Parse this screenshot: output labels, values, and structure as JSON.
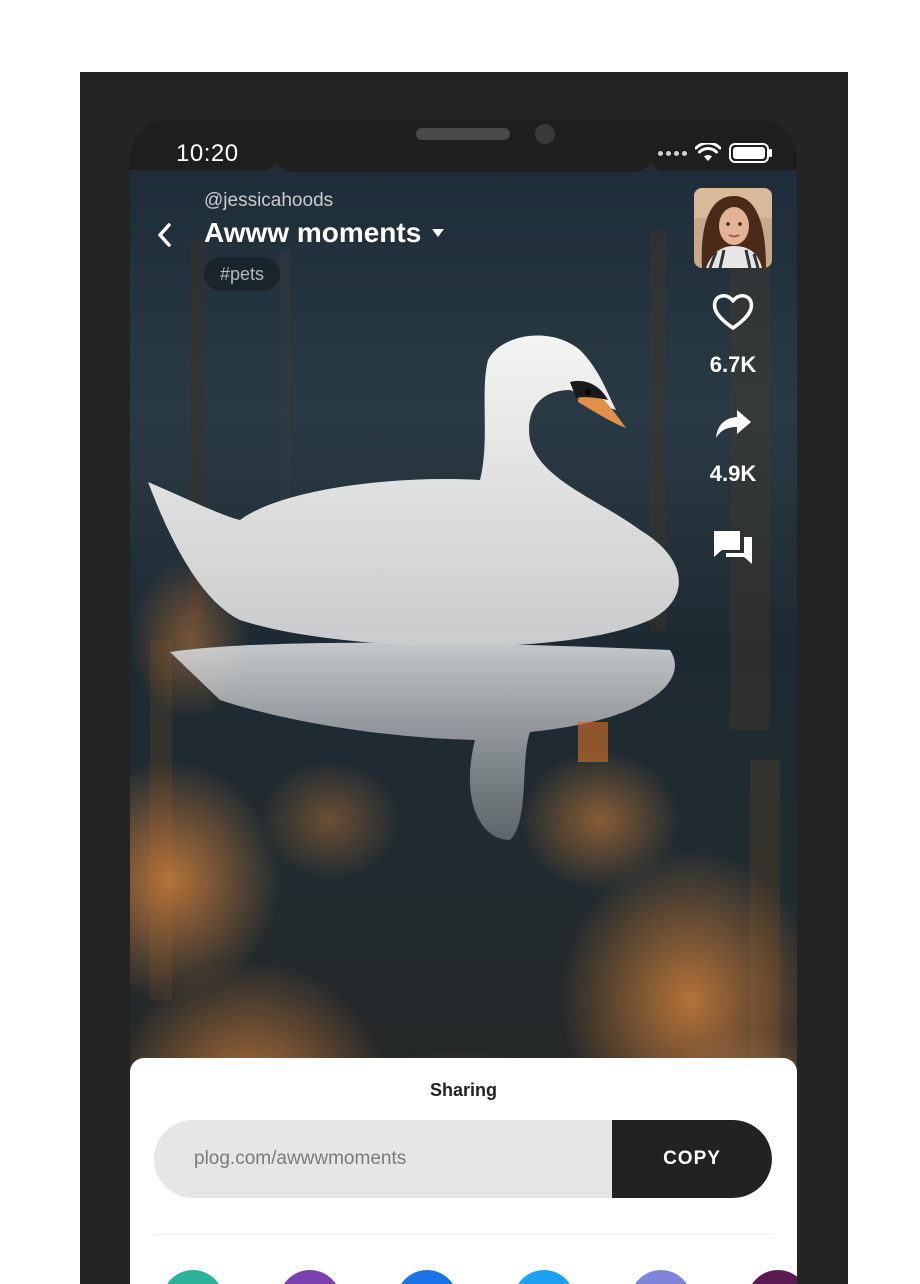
{
  "status_bar": {
    "time": "10:20"
  },
  "header": {
    "username": "@jessicahoods",
    "title": "Awww moments",
    "tag": "#pets"
  },
  "actions": {
    "likes": "6.7K",
    "shares": "4.9K"
  },
  "icons": {
    "back": "chevron-left-icon",
    "dropdown": "caret-down-icon",
    "like": "heart-icon",
    "share": "share-arrow-icon",
    "comments": "comments-icon",
    "wifi": "wifi-icon",
    "battery": "battery-icon"
  },
  "share_sheet": {
    "title": "Sharing",
    "link_value": "plog.com/awwwmoments",
    "copy_label": "COPY",
    "targets": [
      {
        "name": "share-target-teal",
        "color": "#2bb39a"
      },
      {
        "name": "share-target-purple",
        "color": "#7b3fb0"
      },
      {
        "name": "share-target-blue",
        "color": "#1a73e8"
      },
      {
        "name": "share-target-skyblue",
        "color": "#1da1f2"
      },
      {
        "name": "share-target-periwinkle",
        "color": "#7e86d9"
      },
      {
        "name": "share-target-plum",
        "color": "#5b1a52"
      }
    ]
  },
  "colors": {
    "frame": "#242424",
    "sheet_background": "#ffffff",
    "copy_button": "#222222",
    "link_field": "#e6e6e6"
  }
}
